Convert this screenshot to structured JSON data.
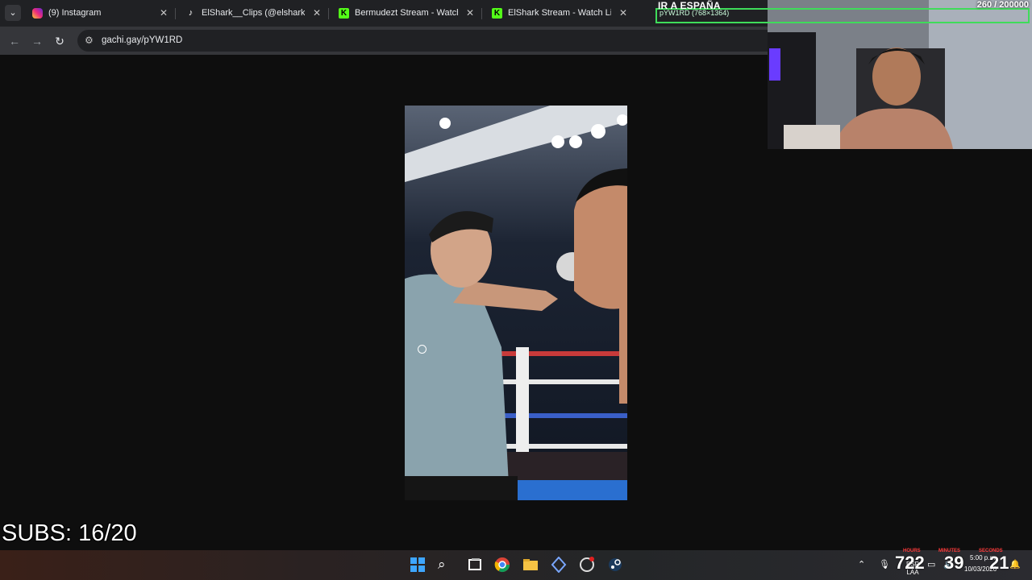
{
  "browser": {
    "tabs": [
      {
        "label": "(9) Instagram",
        "favicon": "instagram-icon"
      },
      {
        "label": "ElShark__Clips (@elshark_clips)",
        "favicon": "tiktok-icon"
      },
      {
        "label": "Bermudezt Stream - Watch Live",
        "favicon": "kick-icon"
      },
      {
        "label": "ElShark Stream - Watch Live on",
        "favicon": "kick-icon"
      }
    ],
    "url": "gachi.gay/pYW1RD"
  },
  "overlay": {
    "title": "IR A ESPAÑA",
    "subtitle": "pYW1RD (768×1364)",
    "goal": "260 / 200000",
    "subs": "SUBS: 16/20"
  },
  "taskbar": {
    "timer_hours": "722",
    "timer_minutes": "39",
    "timer_seconds": "21",
    "timer_hours_label": "HOURS",
    "timer_minutes_label": "MINUTES",
    "timer_seconds_label": "SECONDS",
    "lang": "ESP LAA",
    "time": "5:00 p.m.",
    "date": "10/03/2026"
  },
  "colors": {
    "accent_green": "#3fdc5a",
    "kick_green": "#53fc18",
    "tab_bg": "#202124"
  }
}
